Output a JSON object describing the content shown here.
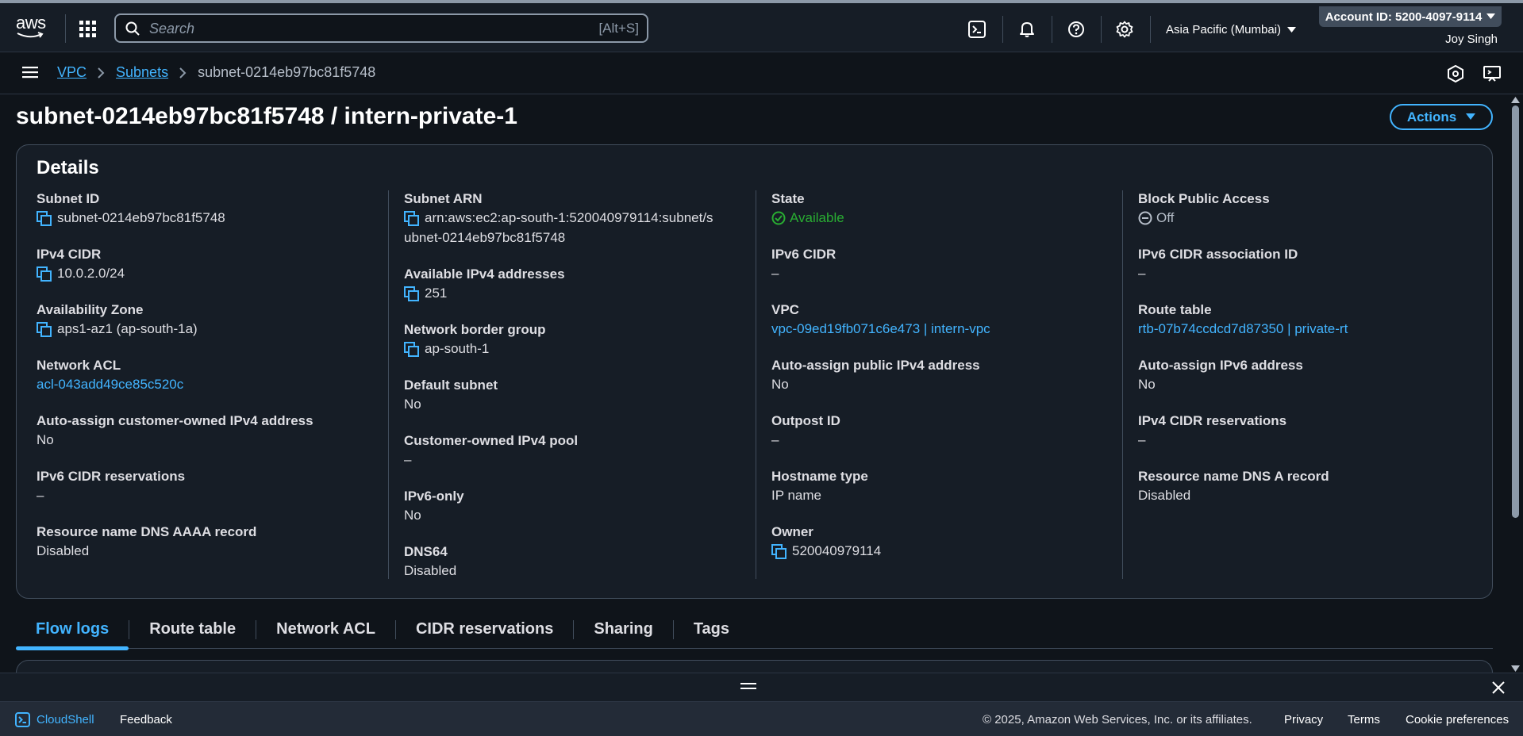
{
  "header": {
    "logo_text": "aws",
    "search_placeholder": "Search",
    "search_shortcut": "[Alt+S]",
    "region": "Asia Pacific (Mumbai)",
    "account": "Account ID: 5200-4097-9114",
    "user": "Joy Singh"
  },
  "breadcrumb": {
    "items": [
      "VPC",
      "Subnets"
    ],
    "current": "subnet-0214eb97bc81f5748"
  },
  "page": {
    "title": "subnet-0214eb97bc81f5748 / intern-private-1",
    "actions_label": "Actions"
  },
  "details": {
    "heading": "Details",
    "col1": {
      "subnet_id": {
        "label": "Subnet ID",
        "value": "subnet-0214eb97bc81f5748"
      },
      "ipv4_cidr": {
        "label": "IPv4 CIDR",
        "value": "10.0.2.0/24"
      },
      "availability_zone": {
        "label": "Availability Zone",
        "value": "aps1-az1 (ap-south-1a)"
      },
      "network_acl": {
        "label": "Network ACL",
        "value": "acl-043add49ce85c520c"
      },
      "auto_assign_customer": {
        "label": "Auto-assign customer-owned IPv4 address",
        "value": "No"
      },
      "ipv6_cidr_reservations": {
        "label": "IPv6 CIDR reservations",
        "value": "–"
      },
      "dns_aaaa": {
        "label": "Resource name DNS AAAA record",
        "value": "Disabled"
      }
    },
    "col2": {
      "subnet_arn": {
        "label": "Subnet ARN",
        "value_line1": "arn:aws:ec2:ap-south-1:520040979114:subnet/s",
        "value_line2": "ubnet-0214eb97bc81f5748"
      },
      "available_ipv4": {
        "label": "Available IPv4 addresses",
        "value": "251"
      },
      "network_border_group": {
        "label": "Network border group",
        "value": "ap-south-1"
      },
      "default_subnet": {
        "label": "Default subnet",
        "value": "No"
      },
      "customer_owned_pool": {
        "label": "Customer-owned IPv4 pool",
        "value": "–"
      },
      "ipv6_only": {
        "label": "IPv6-only",
        "value": "No"
      },
      "dns64": {
        "label": "DNS64",
        "value": "Disabled"
      }
    },
    "col3": {
      "state": {
        "label": "State",
        "value": "Available"
      },
      "ipv6_cidr": {
        "label": "IPv6 CIDR",
        "value": "–"
      },
      "vpc": {
        "label": "VPC",
        "value": "vpc-09ed19fb071c6e473 | intern-vpc"
      },
      "auto_assign_public_ipv4": {
        "label": "Auto-assign public IPv4 address",
        "value": "No"
      },
      "outpost_id": {
        "label": "Outpost ID",
        "value": "–"
      },
      "hostname_type": {
        "label": "Hostname type",
        "value": "IP name"
      },
      "owner": {
        "label": "Owner",
        "value": "520040979114"
      }
    },
    "col4": {
      "block_public_access": {
        "label": "Block Public Access",
        "value": "Off"
      },
      "ipv6_cidr_association": {
        "label": "IPv6 CIDR association ID",
        "value": "–"
      },
      "route_table": {
        "label": "Route table",
        "value": "rtb-07b74ccdcd7d87350 | private-rt"
      },
      "auto_assign_ipv6": {
        "label": "Auto-assign IPv6 address",
        "value": "No"
      },
      "ipv4_cidr_reservations": {
        "label": "IPv4 CIDR reservations",
        "value": "–"
      },
      "dns_a": {
        "label": "Resource name DNS A record",
        "value": "Disabled"
      }
    }
  },
  "tabs": [
    "Flow logs",
    "Route table",
    "Network ACL",
    "CIDR reservations",
    "Sharing",
    "Tags"
  ],
  "footer": {
    "cloudshell": "CloudShell",
    "feedback": "Feedback",
    "copyright": "© 2025, Amazon Web Services, Inc. or its affiliates.",
    "privacy": "Privacy",
    "terms": "Terms",
    "cookies": "Cookie preferences"
  },
  "colors": {
    "link": "#42b4ff",
    "success": "#29ad32",
    "background": "#0f141a",
    "card": "#161d26"
  }
}
